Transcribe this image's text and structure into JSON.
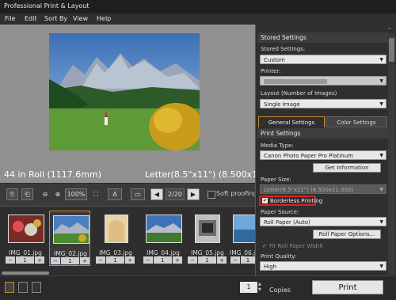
{
  "window": {
    "title": "Professional Print & Layout"
  },
  "menu": {
    "items": [
      "File",
      "Edit",
      "Sort By",
      "View",
      "Help"
    ]
  },
  "preview": {
    "roll_info": "44 in Roll (1117.6mm)",
    "paper_info": "Letter(8.5\"x11\") (8.500x11.000)"
  },
  "toolbar": {
    "zoom": "100%",
    "page": "2/20",
    "soft_proofing": "Soft proofing"
  },
  "thumbnails": [
    {
      "name": "IMG_01.jpg",
      "count": "1"
    },
    {
      "name": "IMG_02.jpg",
      "count": "1"
    },
    {
      "name": "IMG_03.jpg",
      "count": "1"
    },
    {
      "name": "IMG_04.jpg",
      "count": "1"
    },
    {
      "name": "IMG_05.jpg",
      "count": "1"
    },
    {
      "name": "IMG_06.jpg",
      "count": "1"
    }
  ],
  "panel": {
    "stored_settings_header": "Stored Settings",
    "stored_settings_label": "Stored Settings:",
    "stored_settings_value": "Custom",
    "printer_label": "Printer:",
    "layout_label": "Layout (Number of Images)",
    "layout_value": "Single Image",
    "tab_general": "General Settings",
    "tab_color": "Color Settings",
    "print_settings_header": "Print Settings",
    "media_type_label": "Media Type:",
    "media_type_value": "Canon Photo Paper Pro Platinum",
    "get_info_button": "Get Information",
    "paper_size_label": "Paper Size:",
    "paper_size_value": "Letter(8.5\"x11\") (8.500x11.000)",
    "borderless_label": "Borderless Printing",
    "paper_source_label": "Paper Source:",
    "paper_source_value": "Roll Paper (Auto)",
    "roll_paper_options_button": "Roll Paper Options...",
    "fit_roll_label": "Fit Roll Paper Width",
    "print_quality_label": "Print Quality:",
    "print_quality_value": "High"
  },
  "bottom": {
    "copies_value": "1",
    "copies_label": "Copies",
    "print_button": "Print"
  },
  "colors": {
    "accent": "#c88a2e",
    "highlight": "#e02020"
  }
}
